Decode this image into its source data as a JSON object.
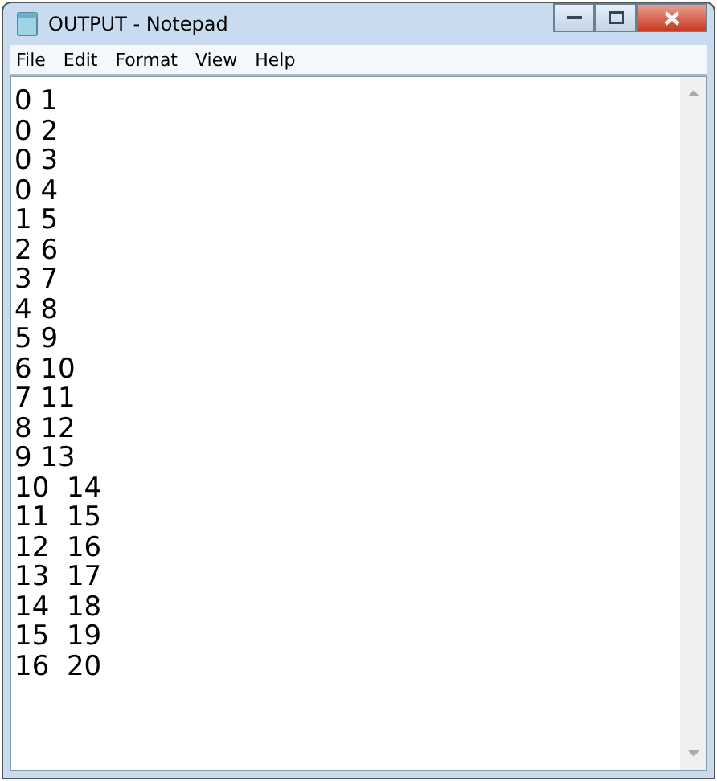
{
  "window": {
    "title": "OUTPUT - Notepad"
  },
  "menu": [
    "File",
    "Edit",
    "Format",
    "View",
    "Help"
  ],
  "lines": [
    "0 1",
    "0 2",
    "0 3",
    "0 4",
    "1 5",
    "2 6",
    "3 7",
    "4 8",
    "5 9",
    "6 10",
    "7 11",
    "8 12",
    "9 13",
    "10  14",
    "11  15",
    "12  16",
    "13  17",
    "14  18",
    "15  19",
    "16  20"
  ]
}
